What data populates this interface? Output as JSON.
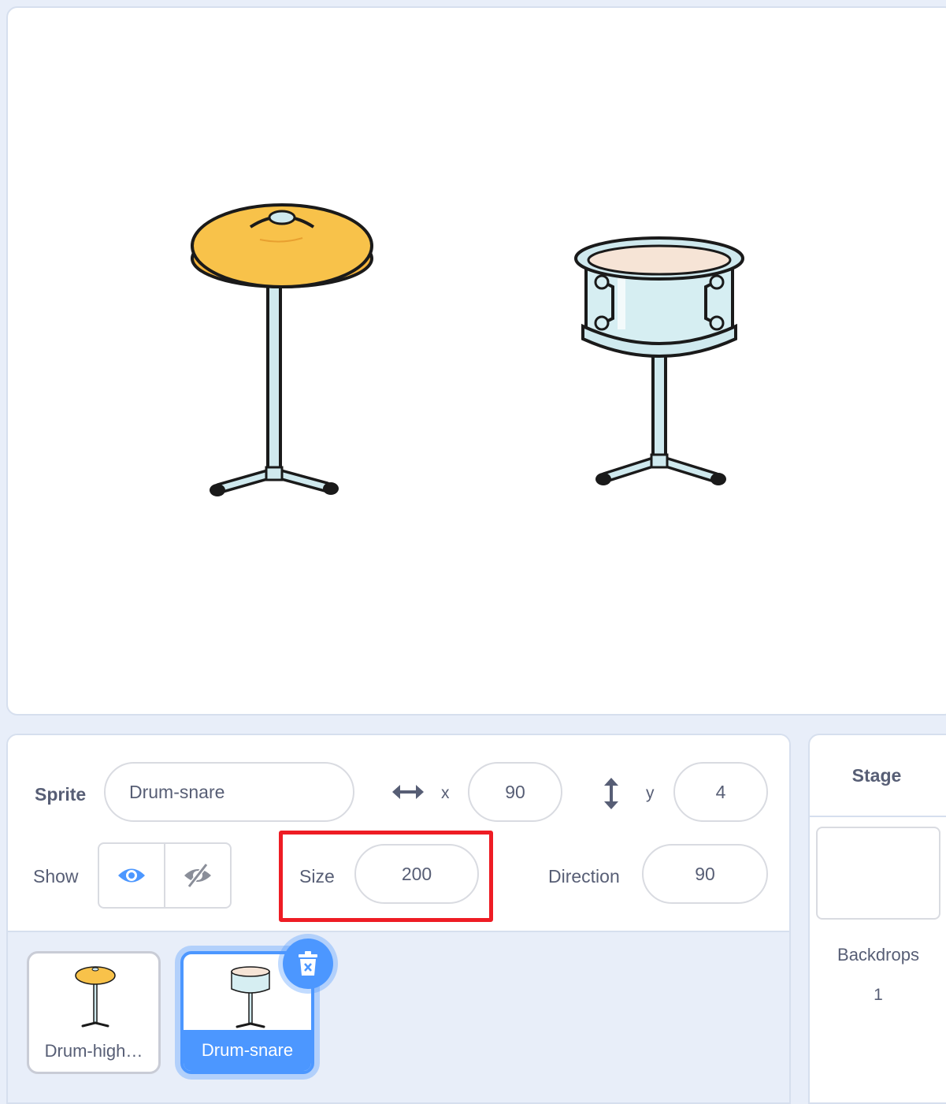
{
  "stage": {
    "sprites": [
      {
        "name": "Drum-highhat",
        "icon": "cymbal-stand-icon"
      },
      {
        "name": "Drum-snare",
        "icon": "snare-drum-icon"
      }
    ]
  },
  "sprite_info": {
    "sprite_label": "Sprite",
    "sprite_name": "Drum-snare",
    "x_label": "x",
    "x_value": "90",
    "y_label": "y",
    "y_value": "4",
    "show_label": "Show",
    "size_label": "Size",
    "size_value": "200",
    "direction_label": "Direction",
    "direction_value": "90"
  },
  "sprite_list": [
    {
      "label": "Drum-high…",
      "selected": false,
      "icon": "cymbal-thumb-icon"
    },
    {
      "label": "Drum-snare",
      "selected": true,
      "icon": "snare-thumb-icon"
    }
  ],
  "stage_panel": {
    "title": "Stage",
    "backdrops_label": "Backdrops",
    "backdrops_count": "1"
  },
  "colors": {
    "accent": "#4c97ff",
    "highlight": "#ee1c24",
    "text": "#575e75",
    "panel_bg": "#e8eef9"
  }
}
